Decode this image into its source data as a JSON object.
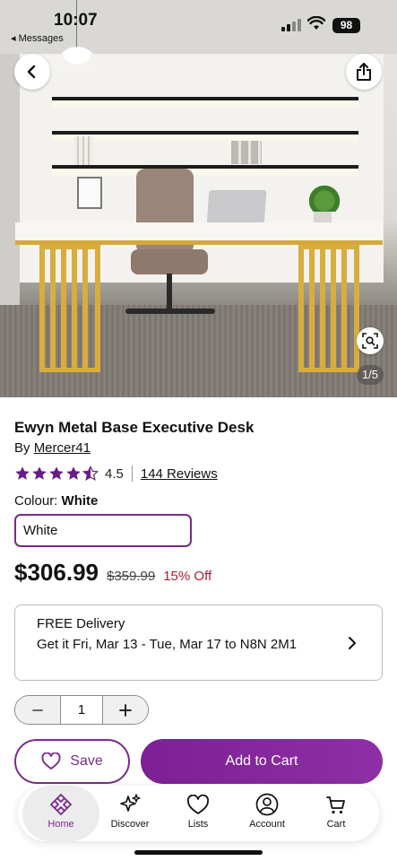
{
  "status_bar": {
    "time": "10:07",
    "back_app": "◂ Messages",
    "battery": "98"
  },
  "hero": {
    "image_counter": "1/5"
  },
  "product": {
    "title": "Ewyn Metal Base Executive Desk",
    "by_prefix": "By ",
    "brand": "Mercer41",
    "rating": "4.5",
    "rating_stars": 4.5,
    "reviews_label": "144 Reviews",
    "colour_label": "Colour: ",
    "colour_value": "White",
    "colour_option": "White",
    "price": "$306.99",
    "was_price": "$359.99",
    "discount": "15% Off"
  },
  "delivery": {
    "line1": "FREE Delivery",
    "line2": "Get it Fri, Mar 13 - Tue, Mar 17 to N8N 2M1"
  },
  "quantity": {
    "value": "1",
    "minus": "−",
    "plus": "+"
  },
  "actions": {
    "save_label": "Save",
    "add_to_cart_label": "Add to Cart"
  },
  "tabs": [
    {
      "label": "Home",
      "icon": "home-icon",
      "active": true
    },
    {
      "label": "Discover",
      "icon": "sparkle-icon",
      "active": false
    },
    {
      "label": "Lists",
      "icon": "heart-icon",
      "active": false
    },
    {
      "label": "Account",
      "icon": "account-icon",
      "active": false
    },
    {
      "label": "Cart",
      "icon": "cart-icon",
      "active": false
    }
  ],
  "colors": {
    "brand_purple": "#7b2a8c",
    "discount_red": "#b01c38"
  }
}
